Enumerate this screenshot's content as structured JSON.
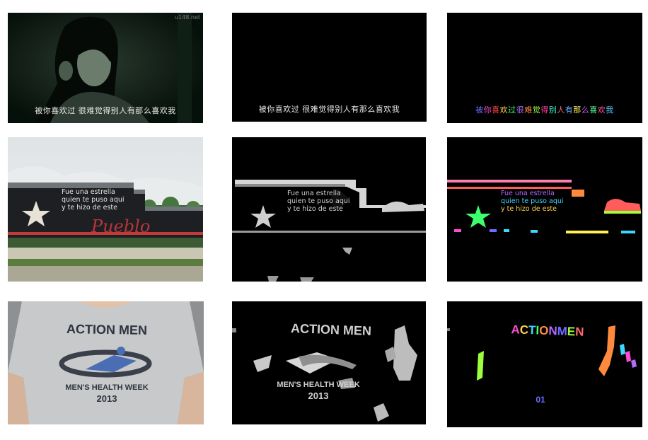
{
  "row1": {
    "subtitle": "被你喜欢过 很难觉得别人有那么喜欢我",
    "watermark": "u148.net",
    "colors": [
      "#6f6cff",
      "#ff4dd2",
      "#ff4040",
      "#ffd24d",
      "#3cff6e",
      "#3cd9ff",
      "#b06bff",
      "#ff8a3d",
      "#9dff3c",
      "#ff3c9d",
      "#3cffd9",
      "#ff6b6b",
      "#6bb0ff",
      "#ffee55",
      "#c955ff",
      "#55ff99",
      "#ff5599",
      "#55ccff"
    ]
  },
  "row2": {
    "line1": "Fue una estrella",
    "line2": "quien te puso aqui",
    "line3": "y te hizo de este",
    "script_word": "Pueblo",
    "colors": [
      "#ff4dd2",
      "#ffd24d",
      "#3cd9ff",
      "#3cff6e",
      "#ff8a3d",
      "#b06bff"
    ]
  },
  "row3": {
    "title": "ACTION MEN",
    "subtitle": "MEN'S HEALTH WEEK",
    "year": "2013",
    "detected_fragment": "01",
    "colors": [
      "#ff4dd2",
      "#ffd24d",
      "#3cd9ff",
      "#3cff6e",
      "#ff8a3d",
      "#b06bff",
      "#ff4040",
      "#6f6cff",
      "#9dff3c",
      "#ff6b6b"
    ]
  }
}
